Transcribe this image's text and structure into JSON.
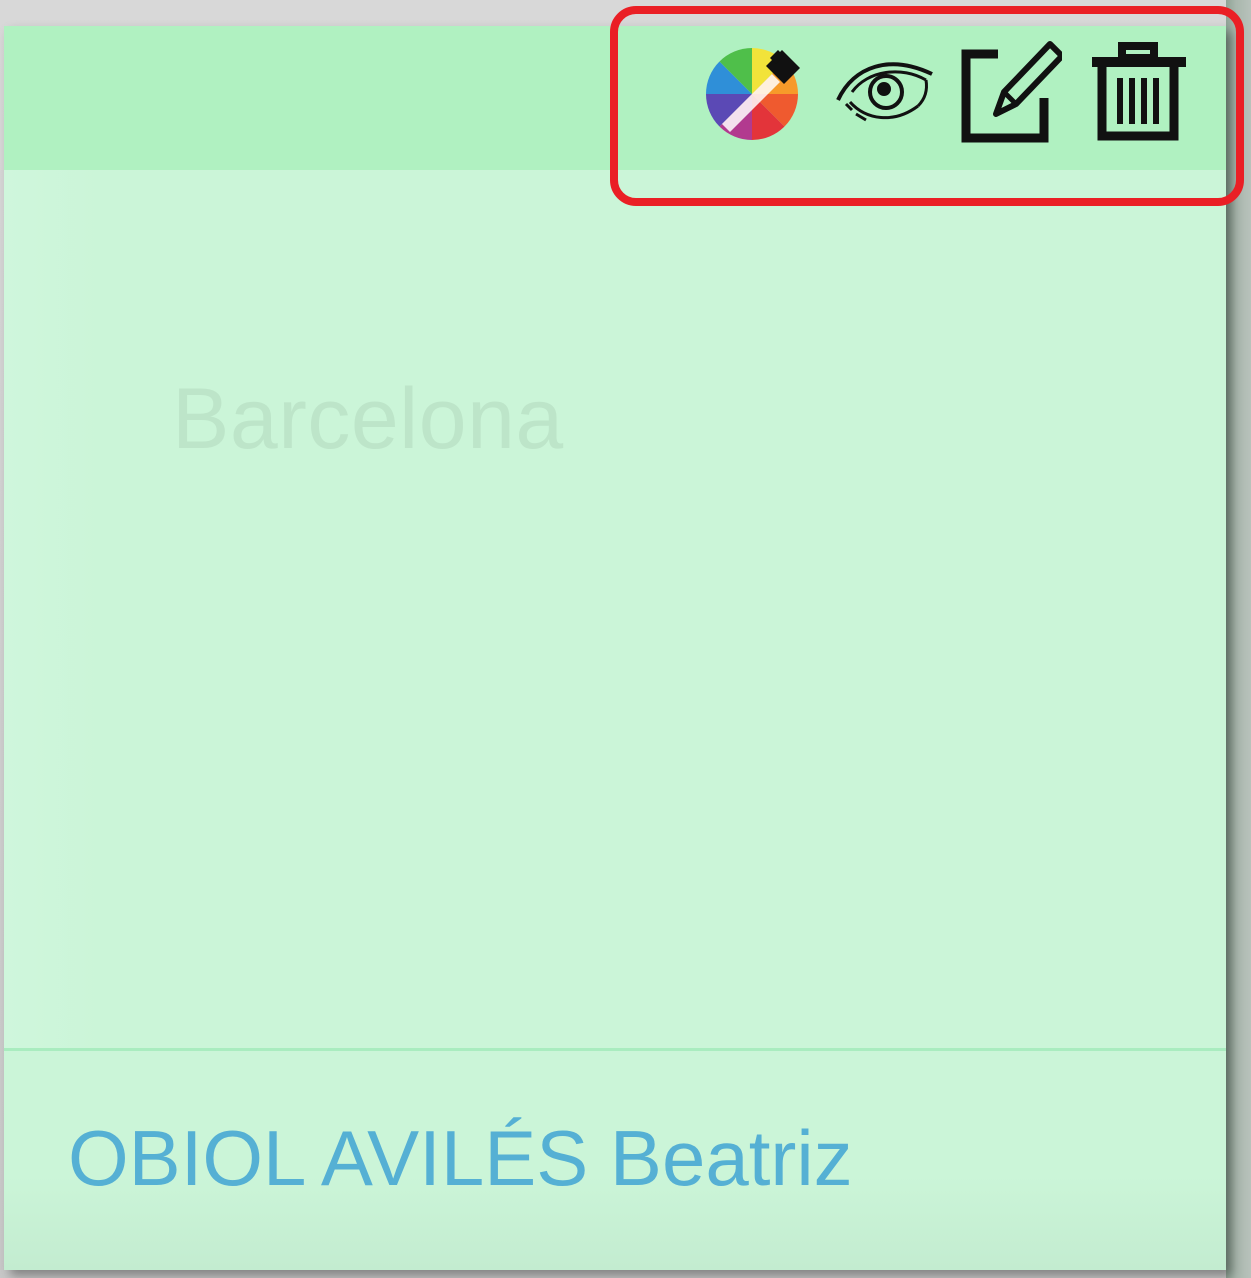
{
  "card": {
    "city": "Barcelona",
    "author": "OBIOL AVILÉS Beatriz"
  },
  "toolbar": {
    "highlighted": true,
    "highlight_color": "#ea1f25",
    "buttons": [
      {
        "name": "color-picker-button",
        "icon": "color-wheel-brush-icon"
      },
      {
        "name": "view-button",
        "icon": "eye-icon"
      },
      {
        "name": "edit-button",
        "icon": "edit-pencil-icon"
      },
      {
        "name": "delete-button",
        "icon": "trash-icon"
      }
    ]
  },
  "colors": {
    "header_bg": "#b0f1c1",
    "body_bg": "#cbf5d8",
    "author_text": "#55b0d4",
    "city_text": "#bde5c9"
  }
}
